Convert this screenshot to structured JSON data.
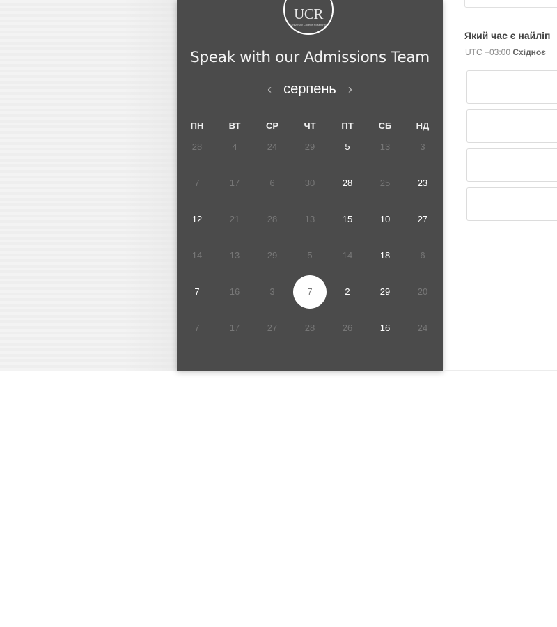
{
  "panel": {
    "logo_text": "UCR",
    "logo_subtext": "University College Rosenthal",
    "title": "Speak with our Admissions Team"
  },
  "calendar": {
    "month": "серпень",
    "prev_arrow": "‹",
    "next_arrow": "›",
    "weekdays": [
      "ПН",
      "ВТ",
      "СР",
      "ЧТ",
      "ПТ",
      "СБ",
      "НД"
    ],
    "days": [
      {
        "label": "28",
        "active": false
      },
      {
        "label": "4",
        "active": false
      },
      {
        "label": "24",
        "active": false
      },
      {
        "label": "29",
        "active": false
      },
      {
        "label": "5",
        "active": true
      },
      {
        "label": "13",
        "active": false
      },
      {
        "label": "3",
        "active": false
      },
      {
        "label": "7",
        "active": false
      },
      {
        "label": "17",
        "active": false
      },
      {
        "label": "6",
        "active": false
      },
      {
        "label": "30",
        "active": false
      },
      {
        "label": "28",
        "active": true
      },
      {
        "label": "25",
        "active": false
      },
      {
        "label": "23",
        "active": true
      },
      {
        "label": "12",
        "active": true
      },
      {
        "label": "21",
        "active": false
      },
      {
        "label": "28",
        "active": false
      },
      {
        "label": "13",
        "active": false
      },
      {
        "label": "15",
        "active": true
      },
      {
        "label": "10",
        "active": true
      },
      {
        "label": "27",
        "active": true
      },
      {
        "label": "14",
        "active": false
      },
      {
        "label": "13",
        "active": false
      },
      {
        "label": "29",
        "active": false
      },
      {
        "label": "5",
        "active": false
      },
      {
        "label": "14",
        "active": false
      },
      {
        "label": "18",
        "active": true
      },
      {
        "label": "6",
        "active": false
      },
      {
        "label": "7",
        "active": true
      },
      {
        "label": "16",
        "active": false
      },
      {
        "label": "3",
        "active": false
      },
      {
        "label": "7",
        "active": false,
        "selected": true
      },
      {
        "label": "2",
        "active": true
      },
      {
        "label": "29",
        "active": true
      },
      {
        "label": "20",
        "active": false
      },
      {
        "label": "7",
        "active": false
      },
      {
        "label": "17",
        "active": false
      },
      {
        "label": "27",
        "active": false
      },
      {
        "label": "28",
        "active": false
      },
      {
        "label": "26",
        "active": false
      },
      {
        "label": "16",
        "active": true
      },
      {
        "label": "24",
        "active": false
      }
    ]
  },
  "form": {
    "question": "Який час є найліп",
    "timezone_offset": "UTC +03:00",
    "timezone_name": "Східноє",
    "time_slots": [
      "",
      "",
      "",
      ""
    ]
  },
  "colors": {
    "panel_bg": "#4b4b4b",
    "active_day": "#ffffff",
    "inactive_day": "#777777",
    "selected_circle": "#ffffff"
  }
}
